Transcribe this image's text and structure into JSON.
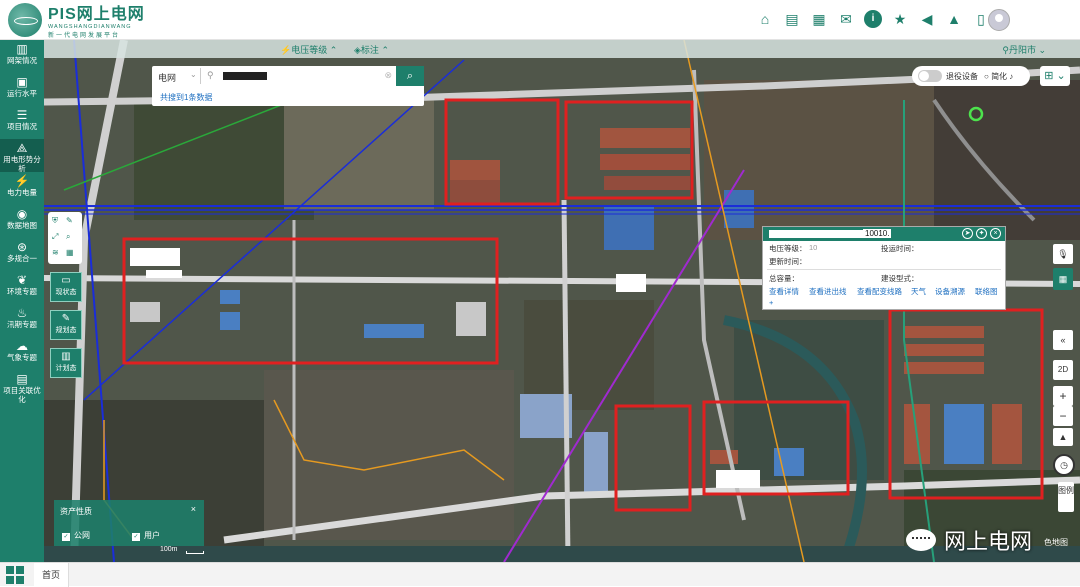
{
  "header": {
    "logo_title": "PIS网上电网",
    "logo_pinyin": "WANGSHANGDIANWANG",
    "logo_subtitle": "新一代电网发展平台",
    "icons": [
      "building-icon",
      "document-icon",
      "chart-icon",
      "chat-icon",
      "info-icon",
      "star-icon",
      "megaphone-icon",
      "broadcast-icon",
      "phone-icon",
      "user-avatar"
    ]
  },
  "sidebar": {
    "items": [
      {
        "label": "网架情况",
        "icon": "grid-icon"
      },
      {
        "label": "运行水平",
        "icon": "monitor-icon"
      },
      {
        "label": "项目情况",
        "icon": "list-icon"
      },
      {
        "label": "用电形势分析",
        "icon": "tower-icon"
      },
      {
        "label": "电力电量",
        "icon": "power-icon"
      },
      {
        "label": "数据地图",
        "icon": "map-icon"
      },
      {
        "label": "多规合一",
        "icon": "layers-icon"
      },
      {
        "label": "环境专题",
        "icon": "leaf-icon"
      },
      {
        "label": "汛期专题",
        "icon": "water-icon"
      },
      {
        "label": "气象专题",
        "icon": "cloud-icon"
      },
      {
        "label": "项目关联优化",
        "icon": "link-icon"
      }
    ]
  },
  "map_toolbar": {
    "voltage_level": "电压等级",
    "label": "标注",
    "region": "丹阳市"
  },
  "search": {
    "type": "电网",
    "result_text": "共搜到1条数据"
  },
  "toggle": {
    "label": "退役设备",
    "simplify": "简化"
  },
  "left_tools": {
    "status_now": "现状态",
    "status_plan": "规划态",
    "status_schedule": "计划态"
  },
  "popup": {
    "code": "10010.",
    "voltage_label": "电压等级：",
    "voltage_value": "10",
    "commission_label": "投运时间：",
    "update_label": "更新时间：",
    "capacity_label": "总容量：",
    "build_type_label": "建设型式：",
    "links": [
      "查看详情",
      "查看进出线",
      "查看配变线路",
      "天气",
      "设备溯源",
      "联络图"
    ],
    "plus": "+"
  },
  "right_controls": {
    "mode": "2D",
    "legend": "图例"
  },
  "asset_panel": {
    "title": "资产性质",
    "close": "×",
    "items": [
      "公网",
      "用户"
    ]
  },
  "scale": "100m",
  "bottom": {
    "home_tab": "首页"
  },
  "watermark": {
    "text": "网上电网",
    "small": "色地图"
  },
  "colors": {
    "brand": "#1e7f6b",
    "highlight_box": "#e02020"
  }
}
